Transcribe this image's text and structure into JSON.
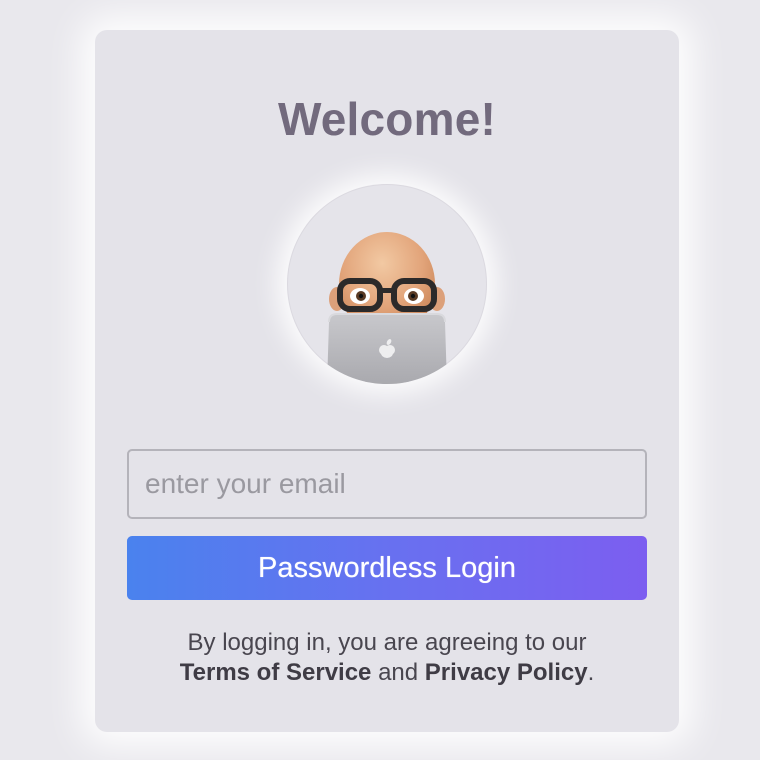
{
  "card": {
    "title": "Welcome!"
  },
  "avatar": {
    "icon": "memoji-laptop-avatar"
  },
  "login": {
    "email_placeholder": "enter your email",
    "email_value": "",
    "button_label": "Passwordless Login"
  },
  "terms": {
    "prefix": "By logging in, you are agreeing to our",
    "terms_link": "Terms of Service",
    "conjunction": "and",
    "privacy_link": "Privacy Policy",
    "suffix": "."
  },
  "colors": {
    "page_background": "#e9e8ed",
    "card_background": "#e4e3e9",
    "title_color": "#726a7d",
    "button_gradient_start": "#4a82ee",
    "button_gradient_end": "#7c5ef0"
  }
}
